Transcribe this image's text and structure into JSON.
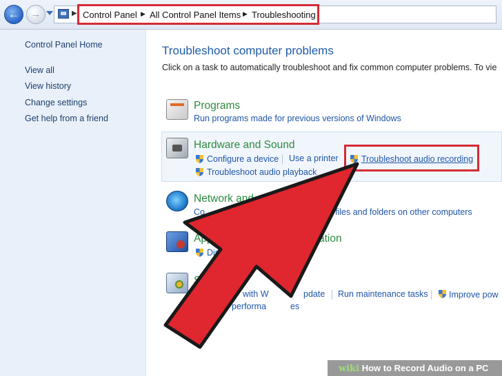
{
  "address_bar": {
    "crumbs": [
      "Control Panel",
      "All Control Panel Items",
      "Troubleshooting"
    ]
  },
  "left_pane": {
    "home": "Control Panel Home",
    "links": [
      "View all",
      "View history",
      "Change settings",
      "Get help from a friend"
    ]
  },
  "main": {
    "title": "Troubleshoot computer problems",
    "subtitle": "Click on a task to automatically troubleshoot and fix common computer problems. To vie"
  },
  "categories": {
    "programs": {
      "title": "Programs",
      "links": [
        "Run programs made for previous versions of Windows"
      ],
      "icon": "programs-icon"
    },
    "hardware": {
      "title": "Hardware and Sound",
      "links": [
        "Configure a device",
        "Use a printer",
        "Troubleshoot audio recording",
        "Troubleshoot audio playback"
      ],
      "icon": "hardware-sound-icon"
    },
    "network": {
      "title": "Network and",
      "links": [
        "Co",
        "files and folders on other computers"
      ],
      "icon": "network-icon"
    },
    "appearance": {
      "title": "Appe",
      "title_tail": "ation",
      "links": [
        "Display"
      ],
      "icon": "appearance-icon"
    },
    "system": {
      "title": "S",
      "links": [
        "with W",
        "pdate",
        "Run maintenance tasks",
        "Improve pow",
        "performa",
        "es"
      ],
      "icon": "system-security-icon"
    }
  },
  "watermark": {
    "wiki": "wiki",
    "text": "How to Record Audio on a PC"
  },
  "colors": {
    "highlight": "#d52b34",
    "arrow_fill": "#e0262e",
    "link": "#1d55a8",
    "category_title": "#2b8a3e"
  }
}
